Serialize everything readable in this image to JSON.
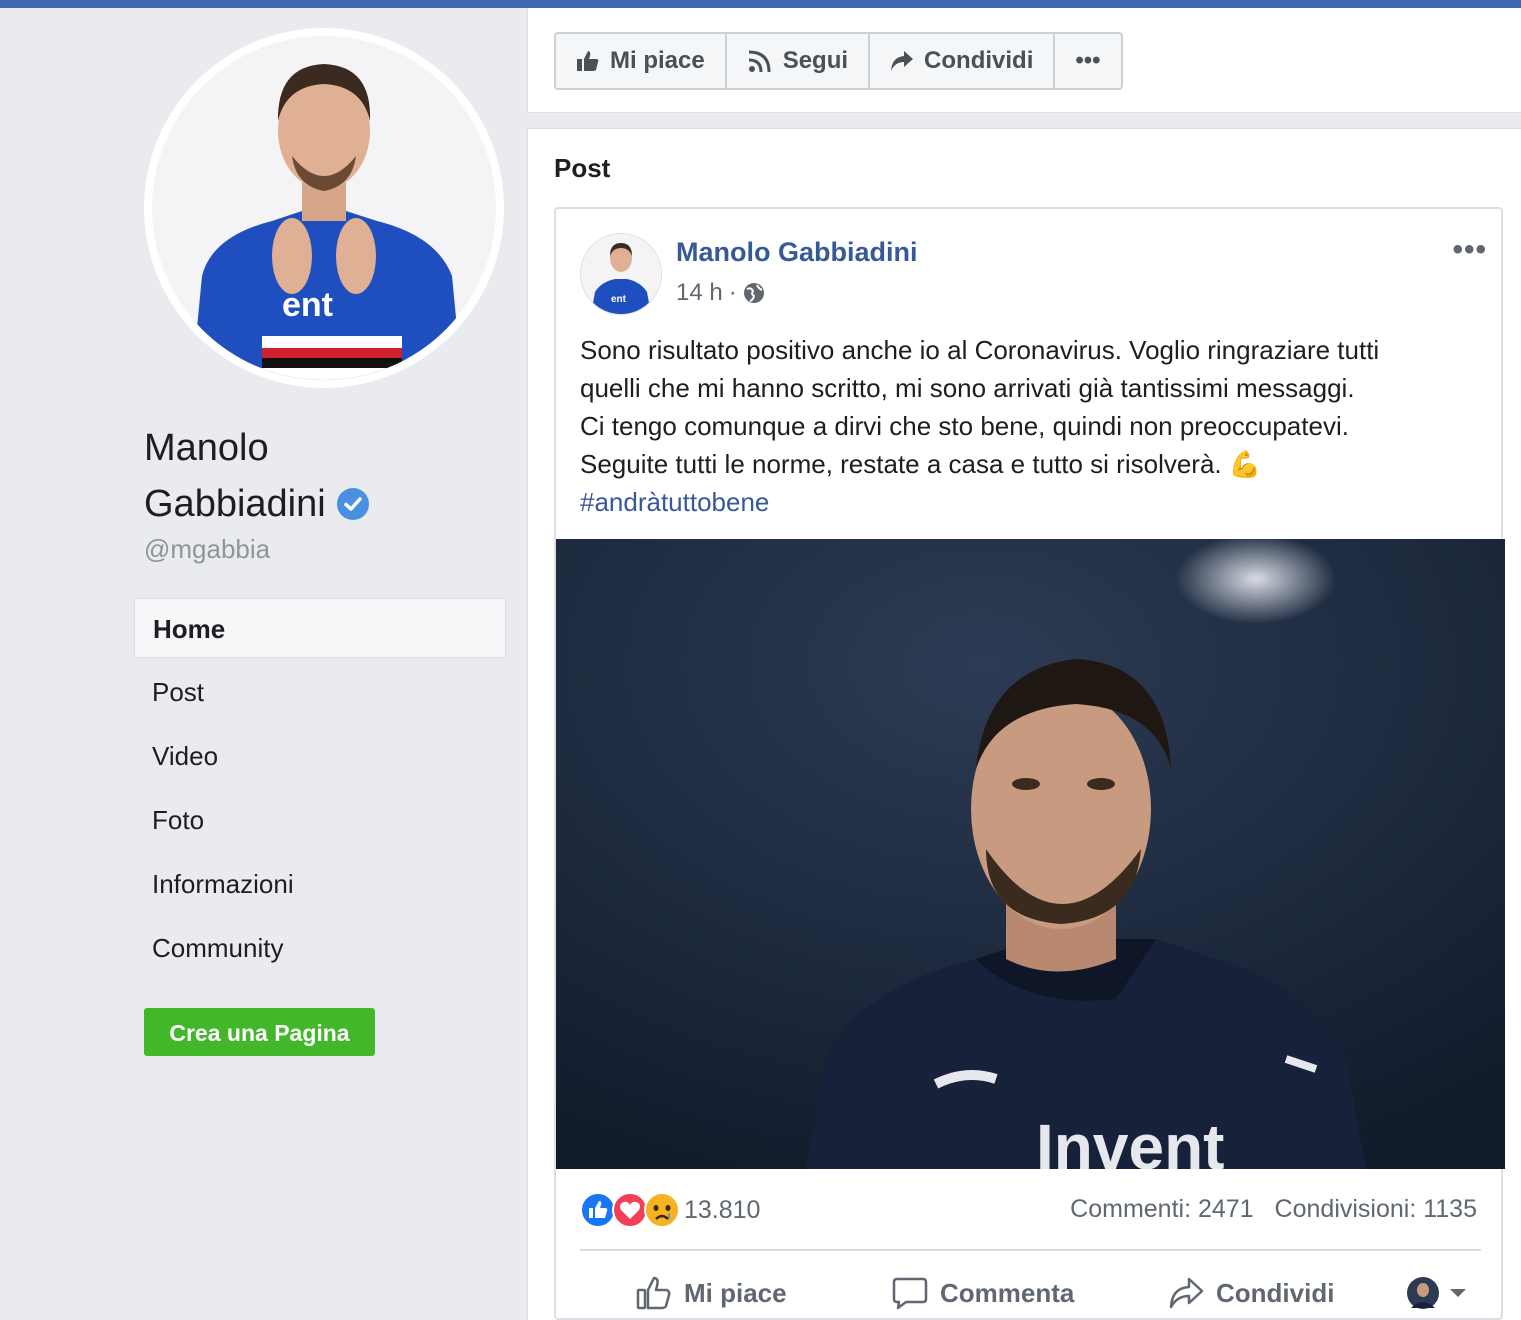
{
  "profile": {
    "name_line1": "Manolo",
    "name_line2": "Gabbiadini",
    "username": "@mgabbia"
  },
  "nav": {
    "items": [
      {
        "label": "Home"
      },
      {
        "label": "Post"
      },
      {
        "label": "Video"
      },
      {
        "label": "Foto"
      },
      {
        "label": "Informazioni"
      },
      {
        "label": "Community"
      }
    ],
    "active_index": 0
  },
  "create_page_label": "Crea una Pagina",
  "actions": {
    "like_label": "Mi piace",
    "follow_label": "Segui",
    "share_label": "Condividi",
    "more_label": "•••"
  },
  "posts_section_title": "Post",
  "post": {
    "author": "Manolo Gabbiadini",
    "time": "14 h",
    "separator": "·",
    "text_lines": [
      "Sono risultato positivo anche io al Coronavirus. Voglio ringraziare tutti",
      "quelli che mi hanno scritto, mi sono arrivati già tantissimi messaggi.",
      "Ci tengo comunque a dirvi che sto bene, quindi non preoccupatevi.",
      "Seguite tutti le norme, restate a casa e tutto si risolverà. 💪"
    ],
    "hashtag": "#andràtuttobene",
    "reactions_count": "13.810",
    "comments": "Commenti: 2471",
    "shares": "Condivisioni: 1135",
    "like_label": "Mi piace",
    "comment_label": "Commenta",
    "share_label": "Condividi",
    "more_label": "•••"
  },
  "colors": {
    "brand": "#4267b2",
    "link": "#385898",
    "green": "#42b72a",
    "background": "#e9ebee"
  }
}
